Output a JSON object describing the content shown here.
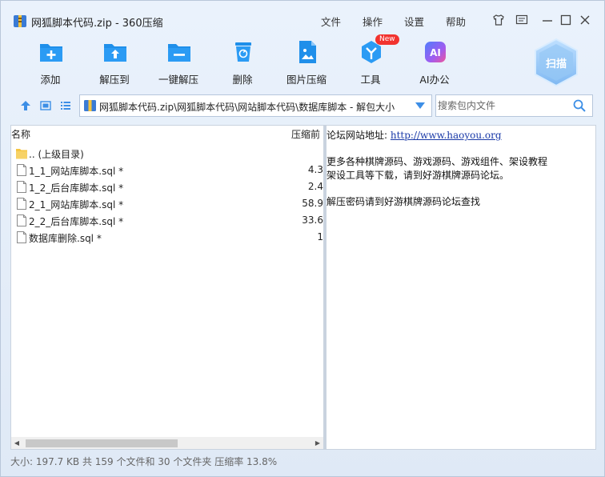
{
  "window": {
    "title": "网狐脚本代码.zip - 360压缩"
  },
  "menu": [
    "文件",
    "操作",
    "设置",
    "帮助"
  ],
  "toolbar": {
    "tools": [
      {
        "label": "添加",
        "icon": "add-icon"
      },
      {
        "label": "解压到",
        "icon": "extract-to-icon"
      },
      {
        "label": "一键解压",
        "icon": "one-click-extract-icon"
      },
      {
        "label": "删除",
        "icon": "trash-icon"
      },
      {
        "label": "图片压缩",
        "icon": "image-compress-icon"
      },
      {
        "label": "工具",
        "icon": "tools-icon",
        "badge": "New"
      },
      {
        "label": "AI办公",
        "icon": "ai-icon",
        "icon_text": "AI"
      }
    ],
    "scan_label": "扫描"
  },
  "address": {
    "path": "网狐脚本代码.zip\\网狐脚本代码\\网站脚本代码\\数据库脚本 - 解包大小",
    "search_placeholder": "搜索包内文件"
  },
  "file_list": {
    "columns": {
      "name": "名称",
      "compressed": "压缩前"
    },
    "rows": [
      {
        "name": ".. (上级目录)",
        "size": "",
        "type": "folder"
      },
      {
        "name": "1_1_网站库脚本.sql *",
        "size": "4.3",
        "type": "file"
      },
      {
        "name": "1_2_后台库脚本.sql *",
        "size": "2.4",
        "type": "file"
      },
      {
        "name": "2_1_网站库脚本.sql *",
        "size": "58.9",
        "type": "file"
      },
      {
        "name": "2_2_后台库脚本.sql *",
        "size": "33.6",
        "type": "file"
      },
      {
        "name": "数据库删除.sql *",
        "size": "1",
        "type": "file"
      }
    ]
  },
  "notes": {
    "forum_label": "论坛网站地址:",
    "forum_url": "http://www.haoyou.org",
    "line2": "更多各种棋牌源码、游戏源码、游戏组件、架设教程",
    "line3": "架设工具等下载，请到好游棋牌源码论坛。",
    "line4": "解压密码请到好游棋牌源码论坛查找"
  },
  "status": {
    "text": "大小: 197.7 KB 共 159 个文件和 30 个文件夹 压缩率 13.8%"
  },
  "colors": {
    "accent": "#1f8fea",
    "badge": "#f2332f",
    "link": "#1a3aa8"
  }
}
